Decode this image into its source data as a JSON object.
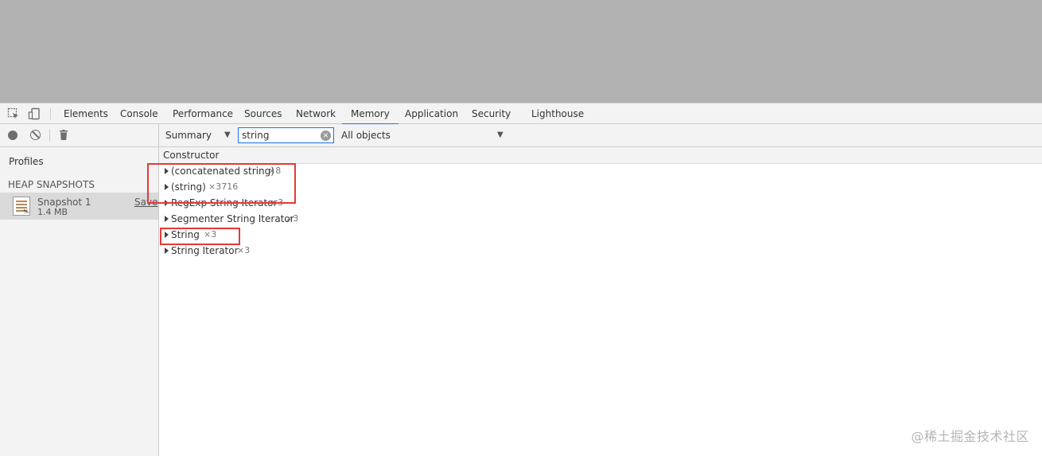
{
  "tabs": [
    {
      "label": "Elements"
    },
    {
      "label": "Console"
    },
    {
      "label": "Performance"
    },
    {
      "label": "Sources"
    },
    {
      "label": "Network"
    },
    {
      "label": "Memory",
      "active": true
    },
    {
      "label": "Application"
    },
    {
      "label": "Security"
    },
    {
      "label": "Lighthouse"
    }
  ],
  "toolbar": {
    "view_select": "Summary",
    "filter_value": "string",
    "objects_select": "All objects"
  },
  "sidebar": {
    "profiles_label": "Profiles",
    "section_header": "HEAP SNAPSHOTS",
    "snapshot": {
      "name": "Snapshot 1",
      "size": "1.4 MB",
      "save_label": "Save"
    }
  },
  "table": {
    "column_header": "Constructor",
    "rows": [
      {
        "name": "(concatenated string)",
        "count": "×8"
      },
      {
        "name": "(string)",
        "count": "×3716"
      },
      {
        "name": "RegExp String Iterator",
        "count": "×3"
      },
      {
        "name": "Segmenter String Iterator",
        "count": "×3"
      },
      {
        "name": "String",
        "count": "×3"
      },
      {
        "name": "String Iterator",
        "count": "×3"
      }
    ]
  },
  "watermark": "@稀土掘金技术社区",
  "colors": {
    "accent": "#1a73e8",
    "highlight": "#e53935"
  }
}
